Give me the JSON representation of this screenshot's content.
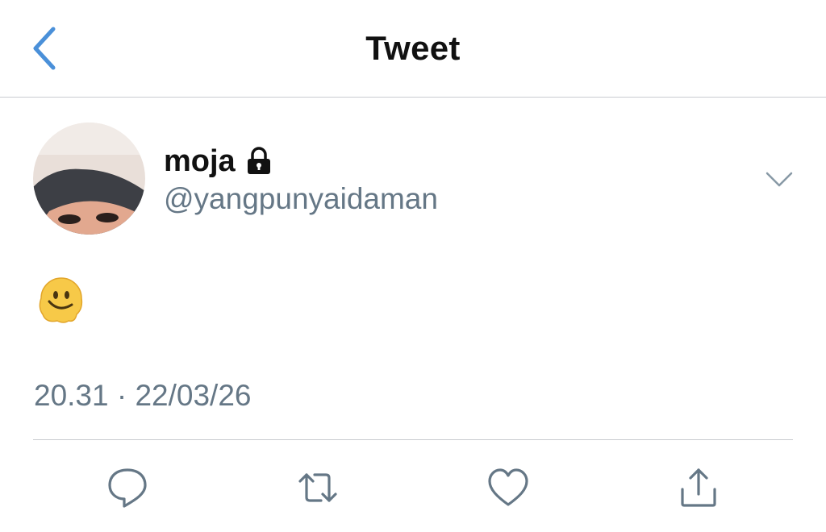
{
  "header": {
    "title": "Tweet"
  },
  "author": {
    "display_name": "moja",
    "handle": "@yangpunyaidaman",
    "protected_icon": "lock-icon"
  },
  "tweet": {
    "content": "🫠",
    "timestamp": "20.31 · 22/03/26"
  },
  "actions": [
    "reply-icon",
    "retweet-icon",
    "like-icon",
    "share-icon"
  ],
  "colors": {
    "accent": "#4a90d9",
    "secondary_text": "#657786",
    "divider": "#c9ccd0"
  }
}
